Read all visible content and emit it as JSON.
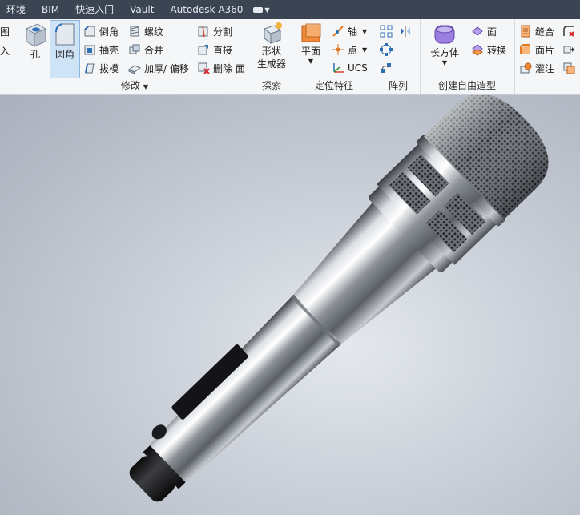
{
  "tabs": [
    {
      "label": "环境"
    },
    {
      "label": "BIM"
    },
    {
      "label": "快速入门"
    },
    {
      "label": "Vault"
    },
    {
      "label": "Autodesk A360"
    }
  ],
  "ribbon": {
    "edge_left": {
      "top": "图",
      "bottom": "入"
    },
    "modify": {
      "title": "修改",
      "hole": "孔",
      "fillet": "圆角",
      "chamfer": "倒角",
      "shell": "抽壳",
      "draft": "拔模",
      "thread": "螺纹",
      "combine": "合并",
      "thicken": "加厚/ 偏移",
      "split": "分割",
      "direct": "直接",
      "delete_face": "删除 面"
    },
    "explore": {
      "title": "探索",
      "shape_gen_line1": "形状",
      "shape_gen_line2": "生成器"
    },
    "work_features": {
      "title": "定位特征",
      "plane": "平面",
      "axis": "轴",
      "point": "点",
      "ucs": "UCS"
    },
    "pattern": {
      "title": "阵列"
    },
    "freeform": {
      "title": "创建自由造型",
      "box": "长方体",
      "face": "面",
      "convert": "转换"
    },
    "surface": {
      "stitch": "缝合",
      "patch": "面片",
      "sculpt": "灌注"
    }
  },
  "colors": {
    "tabbar_bg": "#3b4453",
    "ribbon_bg": "#f5f6f7",
    "accent_blue": "#2f6fb3",
    "selected_bg": "#cfe3f6"
  }
}
